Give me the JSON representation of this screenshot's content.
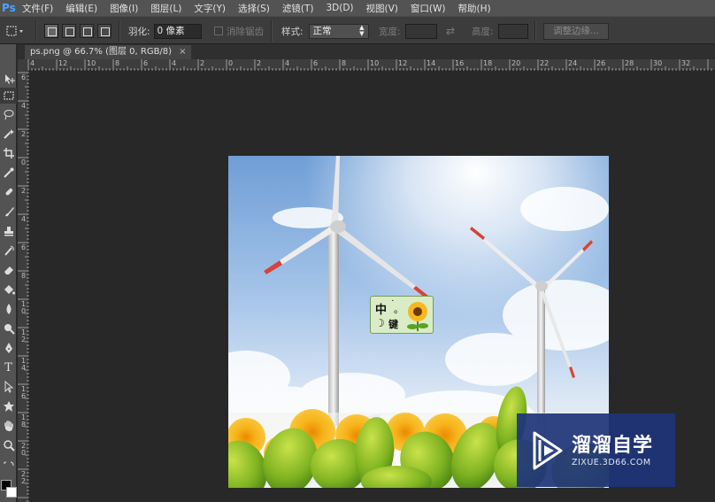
{
  "app": {
    "logo": "Ps"
  },
  "menu": [
    "文件(F)",
    "编辑(E)",
    "图像(I)",
    "图层(L)",
    "文字(Y)",
    "选择(S)",
    "滤镜(T)",
    "3D(D)",
    "视图(V)",
    "窗口(W)",
    "帮助(H)"
  ],
  "options": {
    "feather_label": "羽化:",
    "feather_value": "0 像素",
    "antialias_label": "消除锯齿",
    "style_label": "样式:",
    "style_value": "正常",
    "width_label": "宽度:",
    "height_label": "高度:",
    "refine_edge_button": "调整边缘..."
  },
  "document": {
    "tab_title": "ps.png @ 66.7% (图层 0, RGB/8)",
    "tab_close": "×"
  },
  "ruler": {
    "top_labels": [
      "4",
      "12",
      "10",
      "8",
      "6",
      "4",
      "2",
      "0",
      "2",
      "4",
      "6",
      "8",
      "10",
      "12",
      "14",
      "16",
      "18",
      "20",
      "22",
      "24",
      "26",
      "28",
      "30",
      "32"
    ],
    "left_labels": [
      "6",
      "4",
      "2",
      "0",
      "2",
      "4",
      "6",
      "8",
      "1 0",
      "1 2",
      "1 4",
      "1 6",
      "1 8",
      "2 0",
      "2 2"
    ]
  },
  "ime": {
    "mode": "中",
    "dot": "˙",
    "punct": "。",
    "moon": "☽",
    "keyboard": "键"
  },
  "watermark": {
    "title": "溜溜自学",
    "url": "ZIXUE.3D66.COM"
  },
  "colors": {
    "accent": "#4aa3ff",
    "watermark_bg": "#1e3478"
  }
}
